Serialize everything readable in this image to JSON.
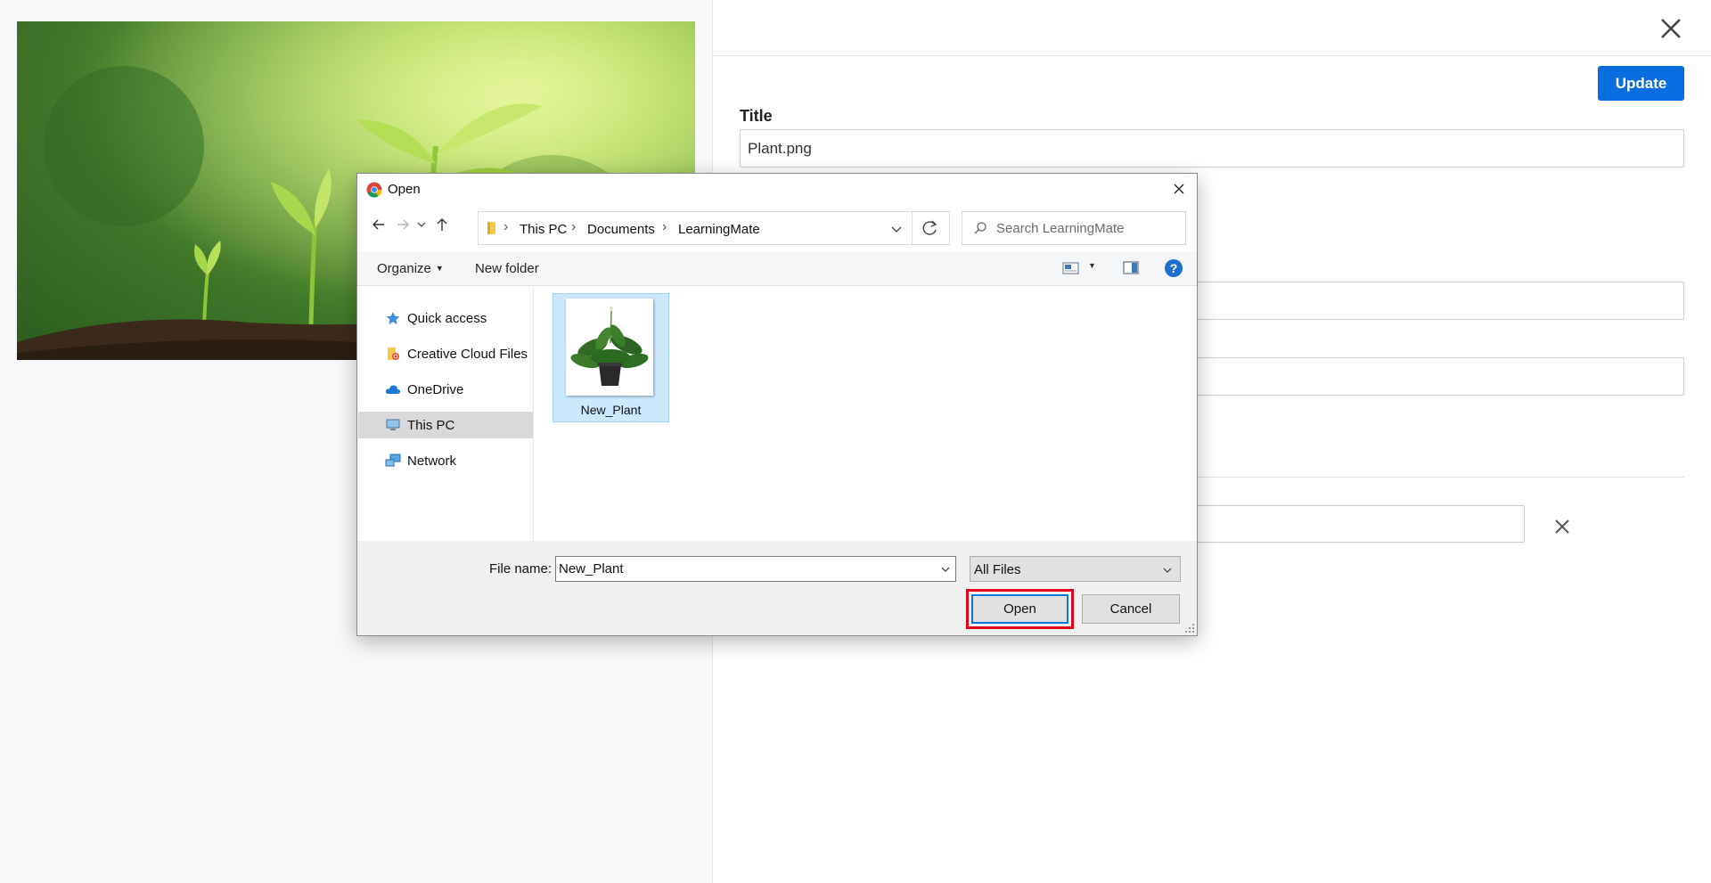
{
  "background_app": {
    "hero_image": {
      "icon": "seedling-photo",
      "colors": {
        "soil": "#3b2a1c",
        "leaf": "#9bcc3e",
        "backdrop": "#6ea33a"
      }
    },
    "update_label": "Update",
    "title_label": "Title",
    "title_value": "Plant.png",
    "accent_color": "#0a6ee0"
  },
  "dialog": {
    "title": "Open",
    "breadcrumbs": [
      "This PC",
      "Documents",
      "LearningMate"
    ],
    "search": {
      "placeholder": "Search LearningMate"
    },
    "toolbar": {
      "organize_label": "Organize",
      "new_folder_label": "New folder"
    },
    "nav_items": [
      {
        "label": "Quick access",
        "icon": "star-icon"
      },
      {
        "label": "Creative Cloud Files",
        "icon": "creative-cloud-folder-icon"
      },
      {
        "label": "OneDrive",
        "icon": "cloud-icon"
      },
      {
        "label": "This PC",
        "icon": "computer-icon",
        "selected": true
      },
      {
        "label": "Network",
        "icon": "network-icon"
      }
    ],
    "files": [
      {
        "name": "New_Plant",
        "selected": true
      }
    ],
    "footer": {
      "filename_label": "File name:",
      "filename_value": "New_Plant",
      "filetype_value": "All Files",
      "open_label": "Open",
      "cancel_label": "Cancel"
    },
    "colors": {
      "selection": "#cce8ff",
      "highlight_border": "#e3001b",
      "focus_border": "#0078d7"
    }
  }
}
